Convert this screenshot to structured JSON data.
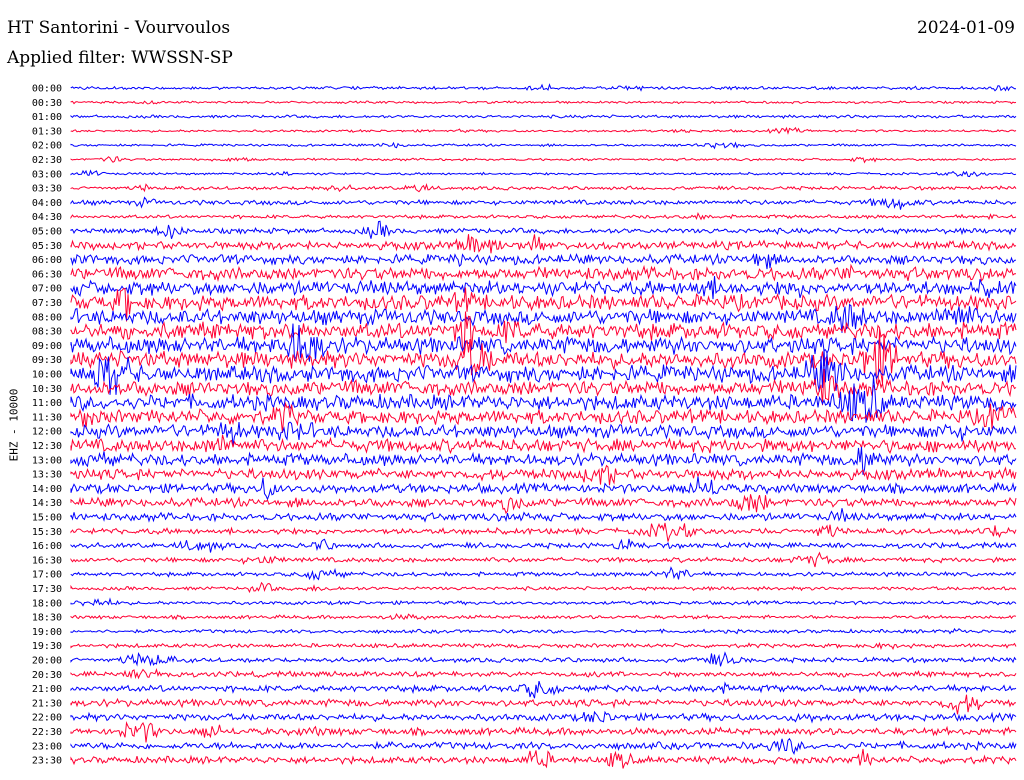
{
  "header": {
    "title": "HT Santorini - Vourvoulos",
    "date": "2024-01-09",
    "filter": "Applied filter: WWSSN-SP"
  },
  "chart_data": {
    "type": "helicorder",
    "ylabel": "EHZ - 10000",
    "colors": [
      "#0000ff",
      "#ff0033"
    ],
    "rows": [
      {
        "t": "00:00",
        "amp": 0.25
      },
      {
        "t": "00:30",
        "amp": 0.2
      },
      {
        "t": "01:00",
        "amp": 0.25
      },
      {
        "t": "01:30",
        "amp": 0.2
      },
      {
        "t": "02:00",
        "amp": 0.2
      },
      {
        "t": "02:30",
        "amp": 0.2
      },
      {
        "t": "03:00",
        "amp": 0.2
      },
      {
        "t": "03:30",
        "amp": 0.3
      },
      {
        "t": "04:00",
        "amp": 0.4
      },
      {
        "t": "04:30",
        "amp": 0.3
      },
      {
        "t": "05:00",
        "amp": 0.45
      },
      {
        "t": "05:30",
        "amp": 0.7
      },
      {
        "t": "06:00",
        "amp": 0.8
      },
      {
        "t": "06:30",
        "amp": 1.1
      },
      {
        "t": "07:00",
        "amp": 1.2
      },
      {
        "t": "07:30",
        "amp": 1.3
      },
      {
        "t": "08:00",
        "amp": 1.3
      },
      {
        "t": "08:30",
        "amp": 1.4
      },
      {
        "t": "09:00",
        "amp": 1.4
      },
      {
        "t": "09:30",
        "amp": 1.4
      },
      {
        "t": "10:00",
        "amp": 1.4
      },
      {
        "t": "10:30",
        "amp": 1.3
      },
      {
        "t": "11:00",
        "amp": 1.3
      },
      {
        "t": "11:30",
        "amp": 1.2
      },
      {
        "t": "12:00",
        "amp": 1.1
      },
      {
        "t": "12:30",
        "amp": 1.1
      },
      {
        "t": "13:00",
        "amp": 1.0
      },
      {
        "t": "13:30",
        "amp": 0.9
      },
      {
        "t": "14:00",
        "amp": 0.8
      },
      {
        "t": "14:30",
        "amp": 0.75
      },
      {
        "t": "15:00",
        "amp": 0.65
      },
      {
        "t": "15:30",
        "amp": 0.5
      },
      {
        "t": "16:00",
        "amp": 0.45
      },
      {
        "t": "16:30",
        "amp": 0.4
      },
      {
        "t": "17:00",
        "amp": 0.35
      },
      {
        "t": "17:30",
        "amp": 0.3
      },
      {
        "t": "18:00",
        "amp": 0.3
      },
      {
        "t": "18:30",
        "amp": 0.3
      },
      {
        "t": "19:00",
        "amp": 0.3
      },
      {
        "t": "19:30",
        "amp": 0.35
      },
      {
        "t": "20:00",
        "amp": 0.4
      },
      {
        "t": "20:30",
        "amp": 0.45
      },
      {
        "t": "21:00",
        "amp": 0.55
      },
      {
        "t": "21:30",
        "amp": 0.6
      },
      {
        "t": "22:00",
        "amp": 0.6
      },
      {
        "t": "22:30",
        "amp": 0.6
      },
      {
        "t": "23:00",
        "amp": 0.6
      },
      {
        "t": "23:30",
        "amp": 0.6
      }
    ]
  }
}
